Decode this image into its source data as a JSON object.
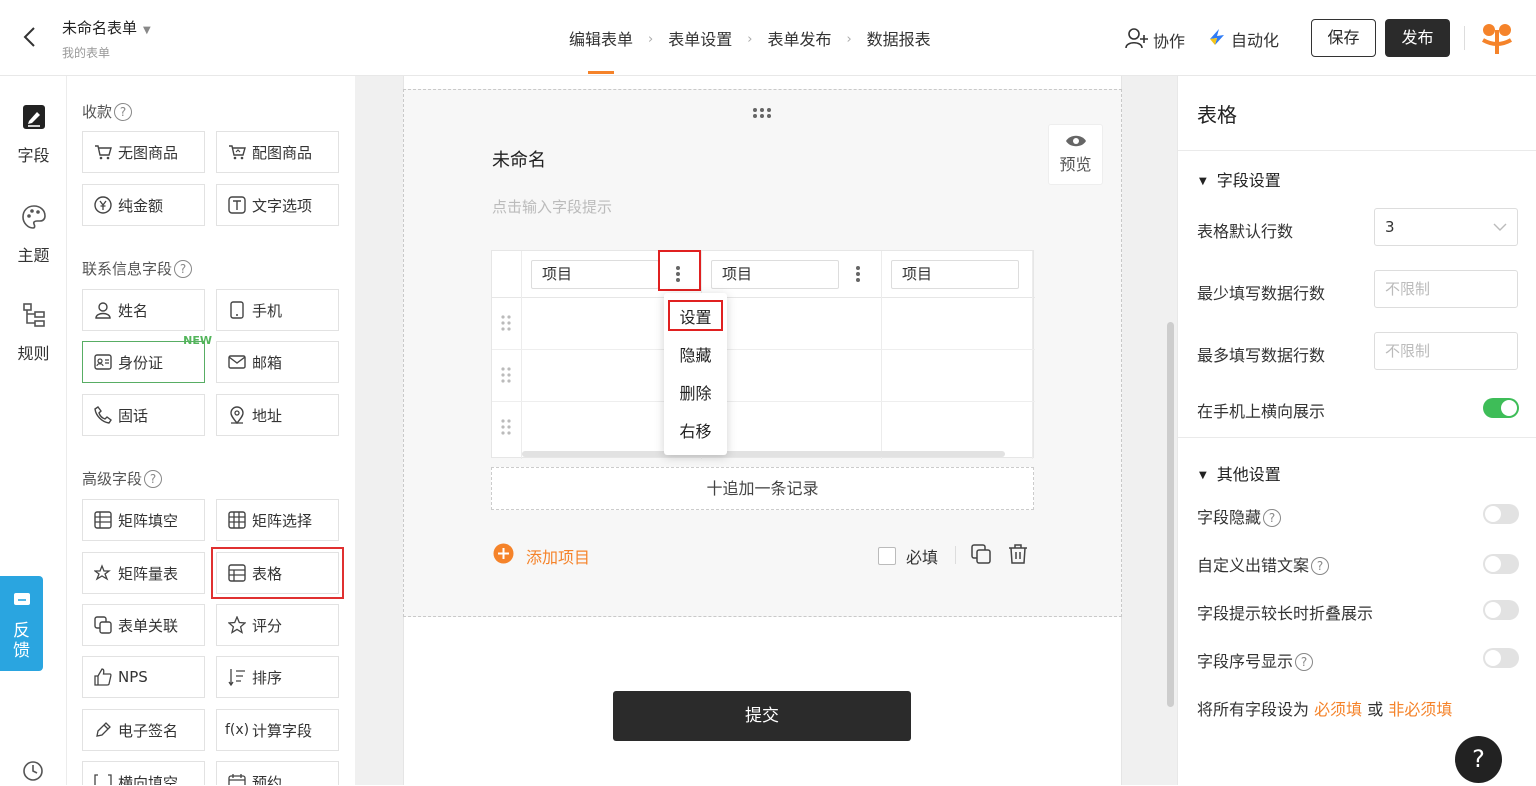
{
  "header": {
    "form_title": "未命名表单",
    "form_subtitle": "我的表单",
    "steps": [
      "编辑表单",
      "表单设置",
      "表单发布",
      "数据报表"
    ],
    "collab": "协作",
    "automation": "自动化",
    "save": "保存",
    "publish": "发布"
  },
  "leftnav": {
    "fields": "字段",
    "theme": "主题",
    "rules": "规则",
    "feedback": "反馈"
  },
  "palette": {
    "group_pay": "收款",
    "group_contact": "联系信息字段",
    "group_advanced": "高级字段",
    "new_badge": "NEW",
    "pay": [
      "无图商品",
      "配图商品",
      "纯金额",
      "文字选项"
    ],
    "contact": [
      "姓名",
      "手机",
      "身份证",
      "邮箱",
      "固话",
      "地址"
    ],
    "advanced": [
      "矩阵填空",
      "矩阵选择",
      "矩阵量表",
      "表格",
      "表单关联",
      "评分",
      "NPS",
      "排序",
      "电子签名",
      "计算字段",
      "横向填空",
      "预约"
    ]
  },
  "form": {
    "field_name": "未命名",
    "field_hint": "点击输入字段提示",
    "preview": "预览",
    "columns": [
      "项目",
      "项目",
      "项目"
    ],
    "menu": [
      "设置",
      "隐藏",
      "删除",
      "右移"
    ],
    "add_record": "十追加一条记录",
    "add_item": "添加项目",
    "required": "必填",
    "submit": "提交"
  },
  "settings": {
    "title": "表格",
    "section_field": "字段设置",
    "default_rows_label": "表格默认行数",
    "default_rows_value": "3",
    "min_rows_label": "最少填写数据行数",
    "min_rows_placeholder": "不限制",
    "max_rows_label": "最多填写数据行数",
    "max_rows_placeholder": "不限制",
    "landscape_label": "在手机上横向展示",
    "landscape_on": true,
    "section_other": "其他设置",
    "hide_label": "字段隐藏",
    "custom_error_label": "自定义出错文案",
    "fold_label": "字段提示较长时折叠展示",
    "seq_label": "字段序号显示",
    "all_prefix": "将所有字段设为",
    "all_required": "必须填",
    "all_or": "或",
    "all_optional": "非必须填"
  },
  "help": "?",
  "colors": {
    "accent": "#f5832a",
    "toggle_on": "#3ebd58",
    "feedback": "#2aa5e0",
    "highlight": "#e02020"
  }
}
